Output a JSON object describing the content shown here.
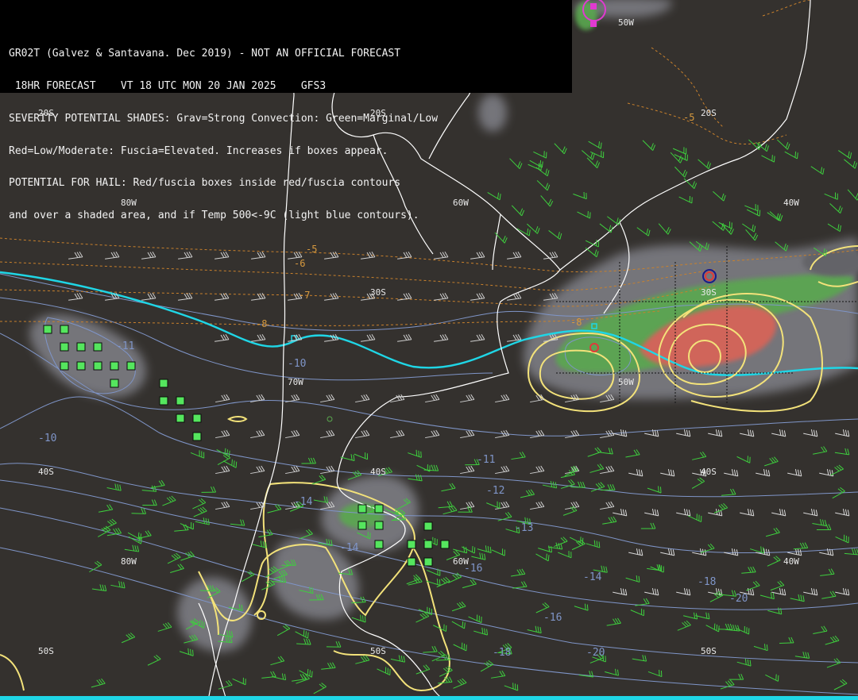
{
  "header": {
    "line1": "GR02T (Galvez & Santavana. Dec 2019) - NOT AN OFFICIAL FORECAST",
    "line2": " 18HR FORECAST    VT 18 UTC MON 20 JAN 2025    GFS3",
    "line3": "SEVERITY POTENTIAL SHADES: Grav=Strong Convection: Green=Marginal/Low",
    "line4": "Red=Low/Moderate: Fuscia=Elevated. Increases if boxes appear.",
    "line5": "POTENTIAL FOR HAIL: Red/fuscia boxes inside red/fuscia contours",
    "line6": "and over a shaded area, and if Temp 500<-9C (light blue contours)."
  },
  "grid_labels": {
    "lat20_left": "20S",
    "lat20_mid": "20S",
    "lat20_right": "20S",
    "lat30_mid": "30S",
    "lat30_right": "30S",
    "lat40_left": "40S",
    "lat40_mid": "40S",
    "lat40_right": "40S",
    "lat50_left": "50S",
    "lat50_mid": "50S",
    "lat50_right": "50S",
    "lon80_top": "80W",
    "lon60_top": "60W",
    "lon40_top": "40W",
    "lon50_top": "50W",
    "lon70_mid": "70W",
    "lon50_mid": "50W",
    "lon80_bot": "80W",
    "lon60_bot": "60W",
    "lon40_bot": "40W"
  },
  "temp_500_labels": {
    "t_m10_a": "-10",
    "t_m10_b": "-10",
    "t_m11": "-11",
    "t_m12": "-12",
    "t_m13": "-13",
    "t_m14_a": "-14",
    "t_m14_b": "-14",
    "t_m14_c": "-14",
    "t_m16_a": "-16",
    "t_m16_b": "-16",
    "t_m18_a": "-18",
    "t_m18_b": "-18",
    "t_m20_a": "-20",
    "t_m20_b": "-20",
    "t_m11_b": "-11"
  },
  "thickness_labels": {
    "a": "-5",
    "b": "-6",
    "c": "-7",
    "d": "-8",
    "e": "-8",
    "f": "-5"
  },
  "colors": {
    "background": "#34312e",
    "coast": "#ffffff",
    "temp_contour": "#7f95c8",
    "cyan_line": "#1fd6e6",
    "yellow_contour": "#f3e27a",
    "orange_dashed": "#c9812c",
    "gray_shade": "#77767c",
    "green_shade": "#5aa84f",
    "red_shade": "#d0655a",
    "hail_box": "#55e65e",
    "wind_barbs_north": "#d2d2d2",
    "wind_barbs_south": "#3ecf3e"
  },
  "icons": [
    "hail-box",
    "wind-barb",
    "low-pressure-marker"
  ]
}
